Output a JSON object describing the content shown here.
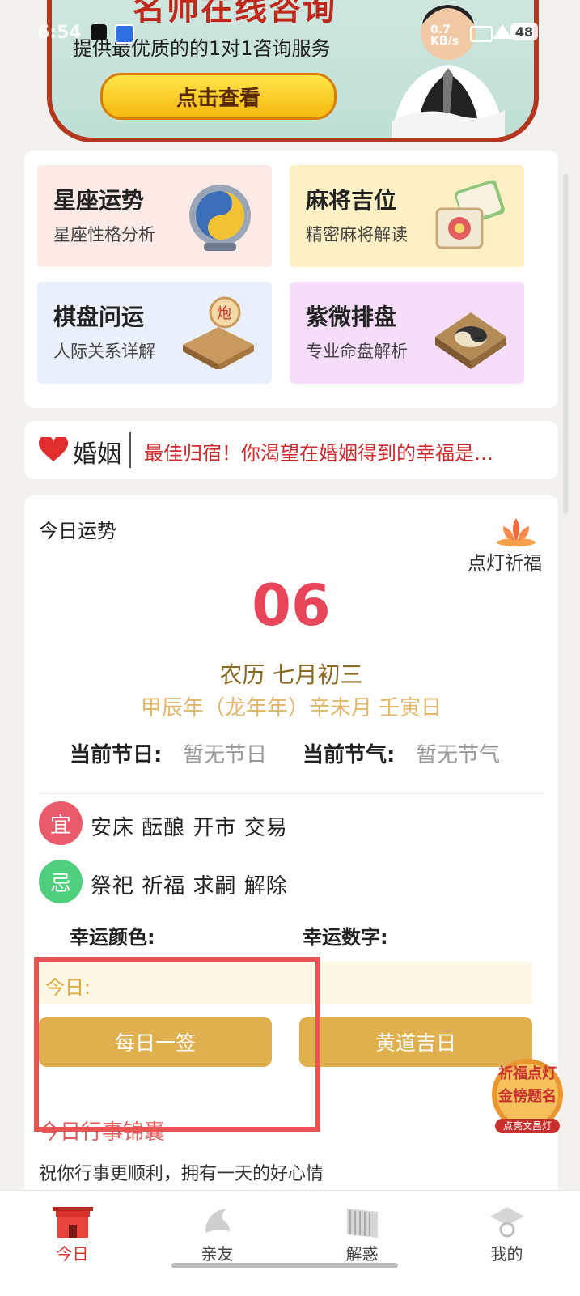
{
  "status_bar": {
    "time": "6:54",
    "net_speed": "0.7\nKB/s",
    "battery": "48"
  },
  "banner": {
    "title": "名师在线咨询",
    "subtitle": "提供最优质的的1对1咨询服务",
    "cta": "点击查看"
  },
  "services": [
    {
      "title": "星座运势",
      "subtitle": "星座性格分析",
      "bg": "#fbeae6",
      "icon": "constellation-globe-icon"
    },
    {
      "title": "麻将吉位",
      "subtitle": "精密麻将解读",
      "bg": "#fdf0c4",
      "icon": "mahjong-tile-icon"
    },
    {
      "title": "棋盘问运",
      "subtitle": "人际关系详解",
      "bg": "#eaf0fb",
      "icon": "chess-board-icon"
    },
    {
      "title": "紫微排盘",
      "subtitle": "专业命盘解析",
      "bg": "#f6ddf9",
      "icon": "bagua-plate-icon"
    }
  ],
  "marriage": {
    "label": "婚姻",
    "text": "最佳归宿！你渴望在婚姻得到的幸福是…"
  },
  "daily": {
    "title": "今日运势",
    "lamp_label": "点灯祈福",
    "day": "06",
    "lunar": "农历 七月初三",
    "ganzhi": "甲辰年（龙年年）辛未月 壬寅日",
    "festival_label": "当前节日:",
    "festival_value": "暂无节日",
    "solar_term_label": "当前节气:",
    "solar_term_value": "暂无节气",
    "yi_label": "宜",
    "yi_text": "安床 酝酿 开市 交易",
    "ji_label": "忌",
    "ji_text": "祭祀 祈福 求嗣 解除",
    "lucky_color_label": "幸运颜色:",
    "lucky_number_label": "幸运数字:",
    "today_label": "今日:",
    "button1": "每日一签",
    "button2": "黄道吉日"
  },
  "float_badge": {
    "line1": "祈福点灯",
    "line2": "金榜题名",
    "line3": "点亮文昌灯"
  },
  "affairs": {
    "title": "今日行事锦囊",
    "subtitle": "祝你行事更顺利，拥有一天的好心情"
  },
  "nav": [
    {
      "label": "今日",
      "icon": "palace-gate-icon",
      "active": true
    },
    {
      "label": "亲友",
      "icon": "dolphin-icon",
      "active": false
    },
    {
      "label": "解惑",
      "icon": "scroll-book-icon",
      "active": false
    },
    {
      "label": "我的",
      "icon": "scholar-hat-icon",
      "active": false
    }
  ],
  "colors": {
    "accent": "#d8332b",
    "gold": "#dfb04d",
    "day_red": "#e8445a"
  }
}
